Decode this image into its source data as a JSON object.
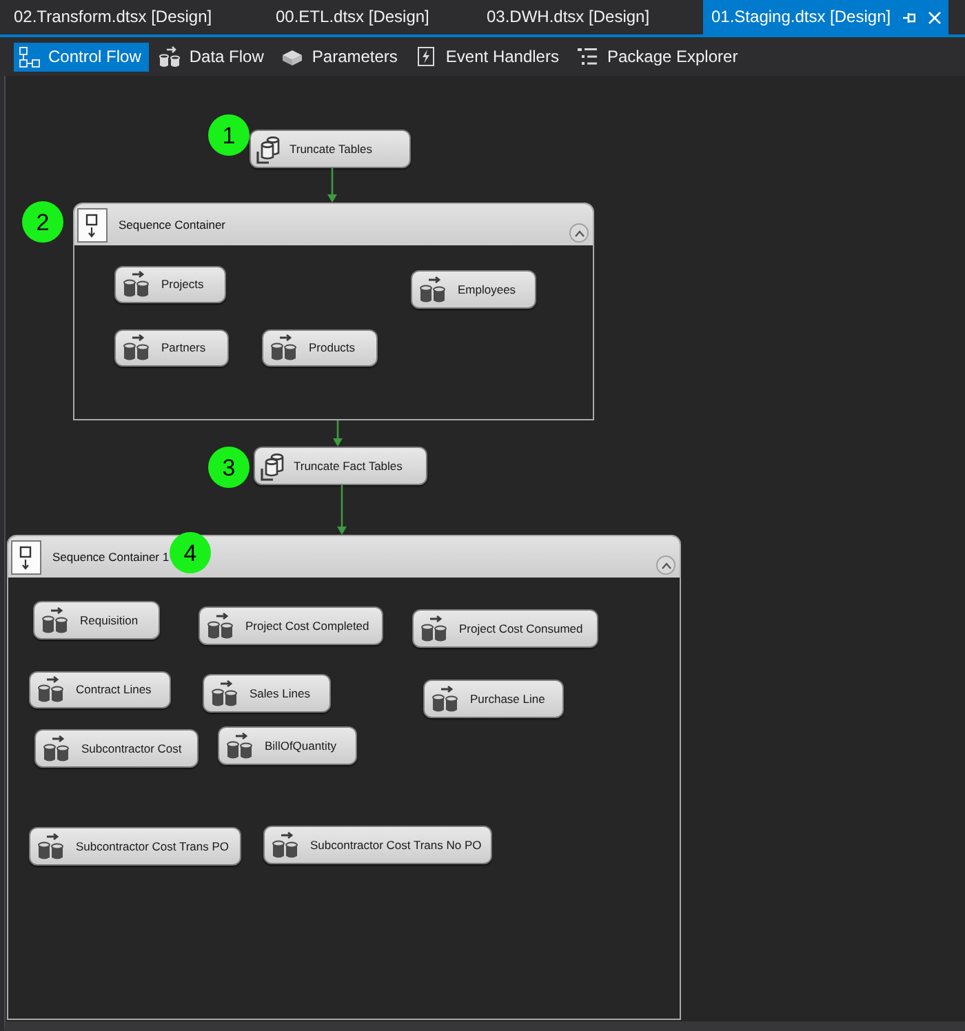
{
  "tabs": [
    {
      "label": "02.Transform.dtsx [Design]",
      "selected": false
    },
    {
      "label": "00.ETL.dtsx [Design]",
      "selected": false
    },
    {
      "label": "03.DWH.dtsx [Design]",
      "selected": false
    },
    {
      "label": "01.Staging.dtsx [Design]",
      "selected": true
    }
  ],
  "designer_tabs": [
    {
      "label": "Control Flow",
      "selected": true
    },
    {
      "label": "Data Flow",
      "selected": false
    },
    {
      "label": "Parameters",
      "selected": false
    },
    {
      "label": "Event Handlers",
      "selected": false
    },
    {
      "label": "Package Explorer",
      "selected": false
    }
  ],
  "canvas": {
    "items": [
      {
        "kind": "sql_task",
        "label": "Truncate Tables",
        "badge": "1"
      },
      {
        "kind": "container",
        "title": "Sequence Container",
        "badge": "2",
        "expanded": true,
        "linked": true,
        "tasks": [
          {
            "kind": "data_flow_task",
            "label": "Projects"
          },
          {
            "kind": "data_flow_task",
            "label": "Employees"
          },
          {
            "kind": "data_flow_task",
            "label": "Partners"
          },
          {
            "kind": "data_flow_task",
            "label": "Products"
          }
        ]
      },
      {
        "kind": "sql_task",
        "label": "Truncate Fact Tables",
        "badge": "3",
        "linked": true
      },
      {
        "kind": "container",
        "title": "Sequence Container 1",
        "badge": "4",
        "expanded": true,
        "linked": true,
        "tasks": [
          {
            "kind": "data_flow_task",
            "label": "Requisition"
          },
          {
            "kind": "data_flow_task",
            "label": "Project Cost Completed"
          },
          {
            "kind": "data_flow_task",
            "label": "Project Cost Consumed"
          },
          {
            "kind": "data_flow_task",
            "label": "Contract Lines"
          },
          {
            "kind": "data_flow_task",
            "label": "Sales Lines"
          },
          {
            "kind": "data_flow_task",
            "label": "Purchase Line"
          },
          {
            "kind": "data_flow_task",
            "label": "Subcontractor Cost"
          },
          {
            "kind": "data_flow_task",
            "label": "BillOfQuantity"
          },
          {
            "kind": "data_flow_task",
            "label": "Subcontractor Cost Trans PO"
          },
          {
            "kind": "data_flow_task",
            "label": "Subcontractor Cost Trans No PO"
          }
        ]
      }
    ]
  }
}
